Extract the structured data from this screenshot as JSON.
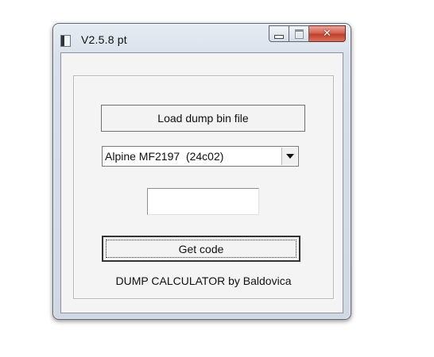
{
  "window": {
    "title": "V2.5.8 pt",
    "minimize_icon": "minimize-icon",
    "maximize_icon": "maximize-icon",
    "close_icon": "close-icon",
    "close_glyph": "✕",
    "close_color": "#c1402a"
  },
  "main": {
    "load_button_label": "Load dump bin file",
    "model_select": {
      "selected": "Alpine MF2197  (24c02)",
      "arrow_icon": "chevron-down-icon"
    },
    "code_field": {
      "value": ""
    },
    "get_code_button_label": "Get code",
    "footer": "DUMP CALCULATOR by Baldovica"
  }
}
